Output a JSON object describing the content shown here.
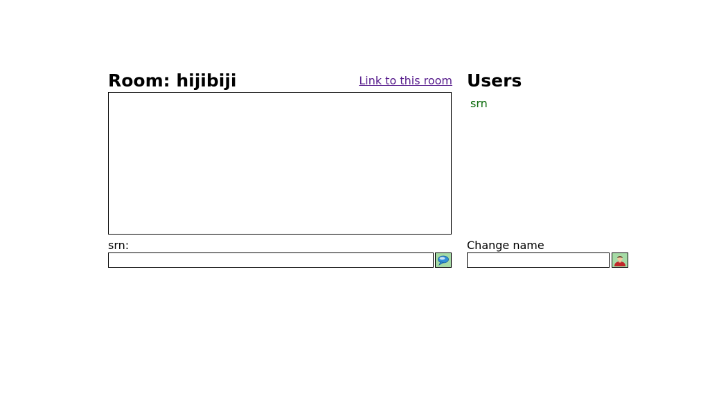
{
  "room": {
    "title": "Room: hijibiji",
    "link_label": "Link to this room"
  },
  "chat": {
    "messages": []
  },
  "message_form": {
    "label": "srn:",
    "value": "",
    "send_icon": "speech-bubble-icon"
  },
  "users": {
    "title": "Users",
    "items": [
      {
        "name": "srn"
      }
    ]
  },
  "name_form": {
    "label": "Change name",
    "value": "",
    "button_icon": "user-avatar-icon"
  },
  "colors": {
    "link": "#551a8b",
    "user_name": "#006400",
    "button_bg": "#a6dba6"
  }
}
